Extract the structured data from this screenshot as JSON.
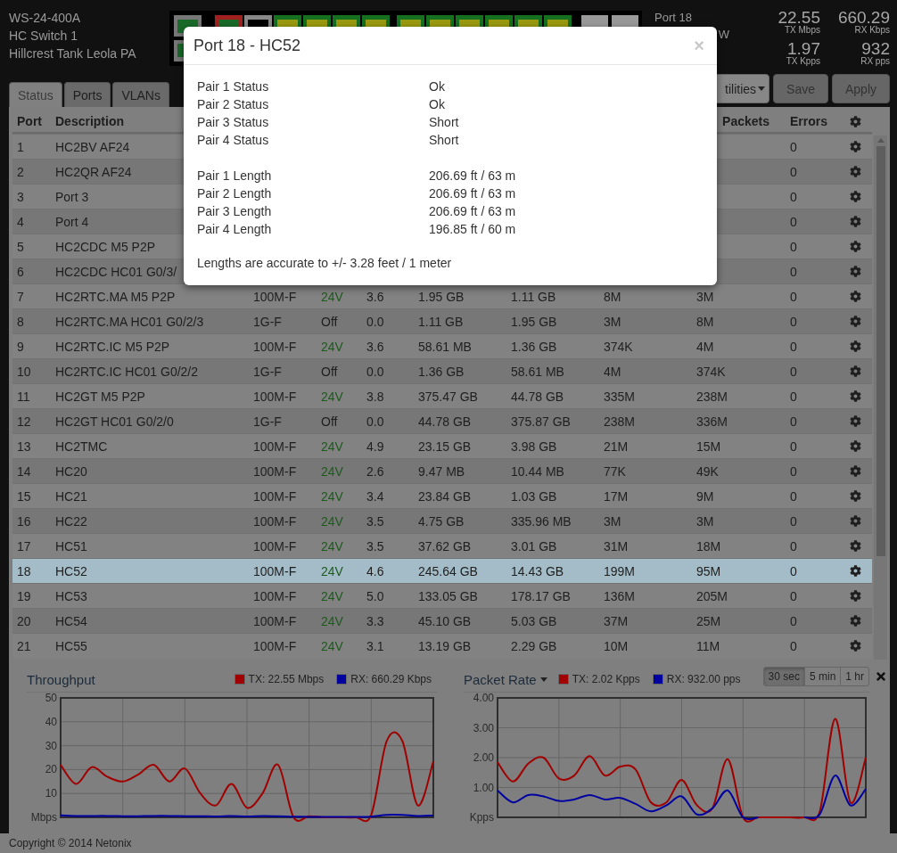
{
  "device": {
    "model": "WS-24-400A",
    "name": "HC Switch 1",
    "location": "Hillcrest Tank Leola PA"
  },
  "port_info": {
    "title": "Port 18",
    "line_2": "W"
  },
  "stats": [
    {
      "value": "22.55",
      "unit": "TX Mbps"
    },
    {
      "value": "660.29",
      "unit": "RX Kbps"
    },
    {
      "value": "1.97",
      "unit": "TX Kpps"
    },
    {
      "value": "932",
      "unit": "RX pps"
    }
  ],
  "tabs": [
    {
      "label": "Status",
      "selected": true
    },
    {
      "label": "Ports",
      "selected": false
    },
    {
      "label": "VLANs",
      "selected": false
    }
  ],
  "toolbar": {
    "menu": "tilities",
    "buttons": [
      "Save",
      "Apply"
    ]
  },
  "table": {
    "columns": [
      "Port",
      "Description",
      null,
      null,
      null,
      null,
      null,
      null,
      "Packets",
      "Errors"
    ],
    "rows": [
      {
        "cells": [
          "1",
          "HC2BV AF24",
          null,
          null,
          null,
          null,
          null,
          null,
          null,
          "0"
        ],
        "selected": false
      },
      {
        "cells": [
          "2",
          "HC2QR AF24",
          null,
          null,
          null,
          null,
          null,
          null,
          null,
          "0"
        ],
        "selected": false
      },
      {
        "cells": [
          "3",
          "Port 3",
          null,
          null,
          null,
          null,
          null,
          null,
          null,
          "0"
        ],
        "selected": false
      },
      {
        "cells": [
          "4",
          "Port 4",
          null,
          null,
          null,
          null,
          null,
          null,
          null,
          "0"
        ],
        "selected": false
      },
      {
        "cells": [
          "5",
          "HC2CDC M5 P2P",
          null,
          null,
          null,
          null,
          null,
          null,
          null,
          "0"
        ],
        "selected": false
      },
      {
        "cells": [
          "6",
          "HC2CDC HC01 G0/3/",
          null,
          null,
          null,
          null,
          null,
          null,
          null,
          "0"
        ],
        "selected": false
      },
      {
        "cells": [
          "7",
          "HC2RTC.MA M5 P2P",
          "100M-F",
          "24V",
          "3.6",
          "1.95 GB",
          "1.11 GB",
          "8M",
          "3M",
          "0"
        ],
        "poe_on": true,
        "selected": false
      },
      {
        "cells": [
          "8",
          "HC2RTC.MA HC01 G0/2/3",
          "1G-F",
          "Off",
          "0.0",
          "1.11 GB",
          "1.95 GB",
          "3M",
          "8M",
          "0"
        ],
        "poe_on": false,
        "selected": false
      },
      {
        "cells": [
          "9",
          "HC2RTC.IC M5 P2P",
          "100M-F",
          "24V",
          "3.6",
          "58.61 MB",
          "1.36 GB",
          "374K",
          "4M",
          "0"
        ],
        "poe_on": true,
        "selected": false
      },
      {
        "cells": [
          "10",
          "HC2RTC.IC HC01 G0/2/2",
          "1G-F",
          "Off",
          "0.0",
          "1.36 GB",
          "58.61 MB",
          "4M",
          "374K",
          "0"
        ],
        "poe_on": false,
        "selected": false
      },
      {
        "cells": [
          "11",
          "HC2GT M5 P2P",
          "100M-F",
          "24V",
          "3.8",
          "375.47 GB",
          "44.78 GB",
          "335M",
          "238M",
          "0"
        ],
        "poe_on": true,
        "selected": false
      },
      {
        "cells": [
          "12",
          "HC2GT HC01 G0/2/0",
          "1G-F",
          "Off",
          "0.0",
          "44.78 GB",
          "375.87 GB",
          "238M",
          "336M",
          "0"
        ],
        "poe_on": false,
        "selected": false
      },
      {
        "cells": [
          "13",
          "HC2TMC",
          "100M-F",
          "24V",
          "4.9",
          "23.15 GB",
          "3.98 GB",
          "21M",
          "15M",
          "0"
        ],
        "poe_on": true,
        "selected": false
      },
      {
        "cells": [
          "14",
          "HC20",
          "100M-F",
          "24V",
          "2.6",
          "9.47 MB",
          "10.44 MB",
          "77K",
          "49K",
          "0"
        ],
        "poe_on": true,
        "selected": false
      },
      {
        "cells": [
          "15",
          "HC21",
          "100M-F",
          "24V",
          "3.4",
          "23.84 GB",
          "1.03 GB",
          "17M",
          "9M",
          "0"
        ],
        "poe_on": true,
        "selected": false
      },
      {
        "cells": [
          "16",
          "HC22",
          "100M-F",
          "24V",
          "3.5",
          "4.75 GB",
          "335.96 MB",
          "3M",
          "3M",
          "0"
        ],
        "poe_on": true,
        "selected": false
      },
      {
        "cells": [
          "17",
          "HC51",
          "100M-F",
          "24V",
          "3.5",
          "37.62 GB",
          "3.01 GB",
          "31M",
          "18M",
          "0"
        ],
        "poe_on": true,
        "selected": false
      },
      {
        "cells": [
          "18",
          "HC52",
          "100M-F",
          "24V",
          "4.6",
          "245.64 GB",
          "14.43 GB",
          "199M",
          "95M",
          "0"
        ],
        "poe_on": true,
        "selected": true
      },
      {
        "cells": [
          "19",
          "HC53",
          "100M-F",
          "24V",
          "5.0",
          "133.05 GB",
          "178.17 GB",
          "136M",
          "205M",
          "0"
        ],
        "poe_on": true,
        "selected": false
      },
      {
        "cells": [
          "20",
          "HC54",
          "100M-F",
          "24V",
          "3.3",
          "45.10 GB",
          "5.03 GB",
          "37M",
          "25M",
          "0"
        ],
        "poe_on": true,
        "selected": false
      },
      {
        "cells": [
          "21",
          "HC55",
          "100M-F",
          "24V",
          "3.1",
          "13.19 GB",
          "2.29 GB",
          "10M",
          "11M",
          "0"
        ],
        "poe_on": true,
        "selected": false
      }
    ]
  },
  "charts": [
    {
      "title": "Throughput",
      "has_menu": false,
      "chart_data": {
        "type": "line",
        "grid": true,
        "ylim": [
          0,
          50
        ],
        "yticks": [
          {
            "value": 0,
            "label": "Mbps"
          },
          10,
          20,
          30,
          40,
          50
        ],
        "series": [
          {
            "name": "TX: 22.55 Mbps",
            "color": "#a00000",
            "values": [
              22,
              14,
              21,
              17,
              15,
              18,
              22,
              15,
              20.5,
              10,
              5,
              14,
              4,
              10,
              22,
              0,
              0.5,
              0,
              0,
              0,
              1,
              32,
              32,
              5,
              23.5
            ]
          },
          {
            "name": "RX: 660.29 Kbps",
            "color": "#0000a0",
            "values": [
              0.8,
              0.6,
              0.6,
              0.6,
              0.5,
              0.5,
              0.6,
              0.6,
              0.5,
              0.5,
              0.4,
              0.6,
              0.4,
              0.6,
              0.5,
              0.3,
              0.2,
              0.2,
              0.2,
              0.2,
              0.3,
              1,
              1,
              0.6,
              0.8
            ]
          }
        ]
      }
    },
    {
      "title": "Packet Rate",
      "has_menu": true,
      "chart_data": {
        "type": "line",
        "grid": true,
        "ylim": [
          0,
          4
        ],
        "yticks": [
          {
            "value": 0,
            "label": "Kpps"
          },
          {
            "value": 1,
            "label": "1.00"
          },
          {
            "value": 2,
            "label": "2.00"
          },
          {
            "value": 3,
            "label": "3.00"
          },
          {
            "value": 4,
            "label": "4.00"
          }
        ],
        "series": [
          {
            "name": "TX: 2.02 Kpps",
            "color": "#a00000",
            "values": [
              1.85,
              1.2,
              1.8,
              2.0,
              1.3,
              1.4,
              2.05,
              1.4,
              1.7,
              1.6,
              0.5,
              0.5,
              1.25,
              0.4,
              0.3,
              1.95,
              0,
              0,
              0,
              0,
              0,
              0.2,
              3.3,
              0.5,
              2.0
            ]
          },
          {
            "name": "RX: 932.00 pps",
            "color": "#0000a0",
            "values": [
              0.9,
              0.5,
              0.75,
              0.7,
              0.55,
              0.6,
              0.75,
              0.6,
              0.65,
              0.45,
              0.2,
              0.4,
              0.7,
              0.1,
              0.3,
              0.9,
              0,
              0,
              null,
              null,
              0,
              0.1,
              1.4,
              0.4,
              0.95
            ]
          }
        ]
      }
    }
  ],
  "time_ranges": [
    {
      "label": "30 sec",
      "selected": true
    },
    {
      "label": "5 min",
      "selected": false
    },
    {
      "label": "1 hr",
      "selected": false
    }
  ],
  "modal": {
    "title": "Port 18 - HC52",
    "close": "×",
    "groups": [
      [
        {
          "label": "Pair 1 Status",
          "value": "Ok"
        },
        {
          "label": "Pair 2 Status",
          "value": "Ok"
        },
        {
          "label": "Pair 3 Status",
          "value": "Short"
        },
        {
          "label": "Pair 4 Status",
          "value": "Short"
        }
      ],
      [
        {
          "label": "Pair 1 Length",
          "value": "206.69 ft / 63 m"
        },
        {
          "label": "Pair 2 Length",
          "value": "206.69 ft / 63 m"
        },
        {
          "label": "Pair 3 Length",
          "value": "206.69 ft / 63 m"
        },
        {
          "label": "Pair 4 Length",
          "value": "196.85 ft / 60 m"
        }
      ]
    ],
    "note": "Lengths are accurate to +/- 3.28 feet / 1 meter"
  },
  "footer": "Copyright © 2014 Netonix"
}
